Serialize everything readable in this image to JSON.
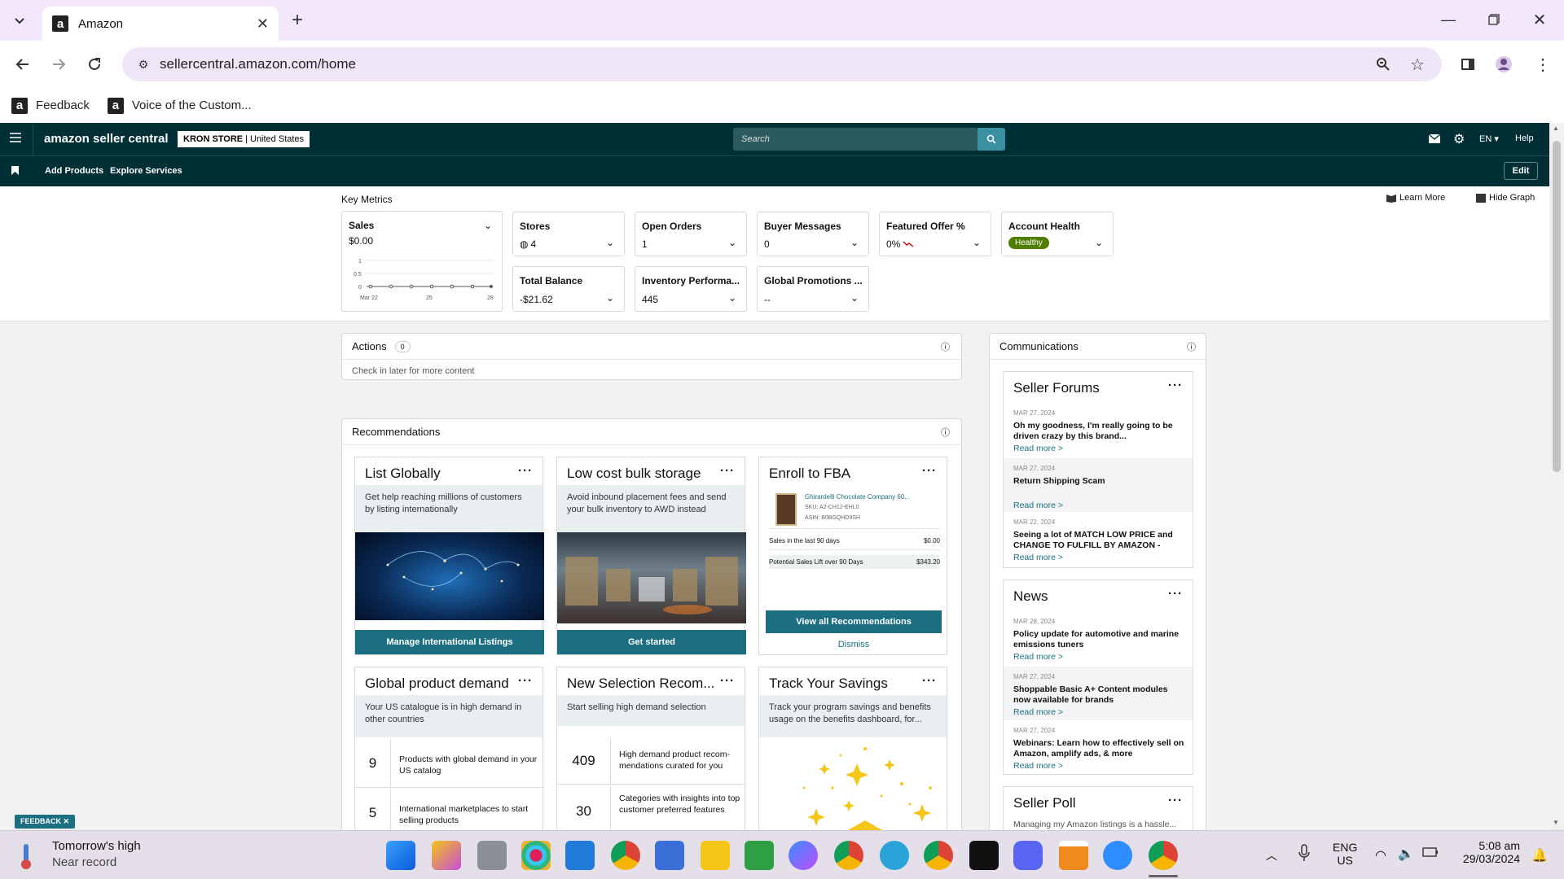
{
  "browser": {
    "tab_title": "Amazon",
    "url": "sellercentral.amazon.com/home",
    "bookmarks": [
      "Feedback",
      "Voice of the Custom..."
    ]
  },
  "header": {
    "logo": "amazon seller central",
    "store_name": "KRON STORE",
    "store_region": "United States",
    "search_placeholder": "Search",
    "language": "EN",
    "help": "Help",
    "nav": [
      "Add Products",
      "Explore Services"
    ],
    "edit": "Edit"
  },
  "metrics": {
    "title": "Key Metrics",
    "learn_more": "Learn More",
    "hide_graph": "Hide Graph",
    "sales": {
      "label": "Sales",
      "value": "$0.00",
      "y_ticks": [
        "1",
        "0.5",
        "0"
      ],
      "x_ticks": [
        "Mar 22",
        "25",
        "28"
      ]
    },
    "stores": {
      "label": "Stores",
      "value": "4"
    },
    "open_orders": {
      "label": "Open Orders",
      "value": "1"
    },
    "buyer_messages": {
      "label": "Buyer Messages",
      "value": "0"
    },
    "featured_offer": {
      "label": "Featured Offer %",
      "value": "0%"
    },
    "account_health": {
      "label": "Account Health",
      "value": "Healthy"
    },
    "total_balance": {
      "label": "Total Balance",
      "value": "-$21.62"
    },
    "inventory": {
      "label": "Inventory Performa...",
      "value": "445"
    },
    "global_promotions": {
      "label": "Global Promotions ...",
      "value": "--"
    }
  },
  "actions": {
    "title": "Actions",
    "count": "0",
    "empty": "Check in later for more content"
  },
  "recommendations": {
    "title": "Recommendations",
    "list_globally": {
      "title": "List Globally",
      "desc": "Get help reaching millions of customers by listing internationally",
      "button": "Manage International Listings"
    },
    "bulk_storage": {
      "title": "Low cost bulk storage",
      "desc": "Avoid inbound placement fees and send your bulk inventory to AWD instead",
      "button": "Get started"
    },
    "fba": {
      "title": "Enroll to FBA",
      "product": "Ghirardelli Chocolate Company 60...",
      "sku": "SKU: A2-CH12-EHL0",
      "asin": "ASIN: B0BGQHD9SH",
      "sales_label": "Sales in the last 90 days",
      "sales_value": "$0.00",
      "lift_label": "Potential Sales Lift over 90 Days",
      "lift_value": "$343.20",
      "button": "View all Recommendations",
      "dismiss": "Dismiss"
    },
    "global_demand": {
      "title": "Global product demand",
      "desc": "Your US catalogue is in high demand in other countries",
      "rows": [
        {
          "num": "9",
          "text": "Products with global demand in your US catalog"
        },
        {
          "num": "5",
          "text": "International marketplaces to start selling products"
        }
      ]
    },
    "new_selection": {
      "title": "New Selection Recom...",
      "desc": "Start selling high demand selection",
      "rows": [
        {
          "num": "409",
          "text": "High demand product recom-mendations curated for you"
        },
        {
          "num": "30",
          "text": "Categories with insights into top customer preferred features"
        }
      ]
    },
    "savings": {
      "title": "Track Your Savings",
      "desc": "Track your program savings and benefits usage on the benefits dashboard, for..."
    }
  },
  "communications": {
    "title": "Communications",
    "forums": {
      "title": "Seller Forums",
      "items": [
        {
          "date": "MAR 27, 2024",
          "text": "Oh my goodness, I'm really going to be driven crazy by this brand...",
          "more": "Read more >"
        },
        {
          "date": "MAR 27, 2024",
          "text": "Return Shipping Scam",
          "more": "Read more >"
        },
        {
          "date": "MAR 22, 2024",
          "text": "Seeing a lot of MATCH LOW PRICE and CHANGE TO FULFILL BY AMAZON -",
          "more": "Read more >"
        }
      ]
    },
    "news": {
      "title": "News",
      "items": [
        {
          "date": "MAR 28, 2024",
          "text": "Policy update for automotive and marine emissions tuners",
          "more": "Read more >"
        },
        {
          "date": "MAR 27, 2024",
          "text": "Shoppable Basic A+ Content modules now available for brands",
          "more": "Read more >"
        },
        {
          "date": "MAR 27, 2024",
          "text": "Webinars: Learn how to effectively sell on Amazon, amplify ads, & more",
          "more": "Read more >"
        }
      ]
    },
    "poll": {
      "title": "Seller Poll",
      "text": "Managing my Amazon listings is a hassle..."
    }
  },
  "feedback_tab": "FEEDBACK",
  "taskbar": {
    "weather_title": "Tomorrow's high",
    "weather_sub": "Near record",
    "lang1": "ENG",
    "lang2": "US",
    "time": "5:08 am",
    "date": "29/03/2024"
  }
}
